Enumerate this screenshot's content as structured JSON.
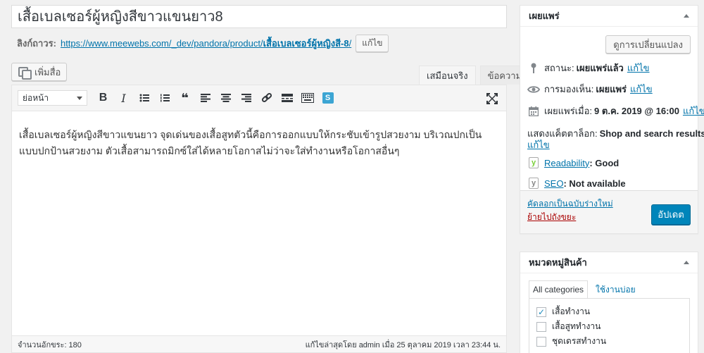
{
  "post": {
    "title": "เสื้อเบลเซอร์ผู้หญิงสีขาวแขนยาว8",
    "permalink_label": "ลิงก์ถาวร:",
    "permalink_base": "https://www.meewebs.com/_dev/pandora/product/",
    "permalink_slug": "เสื้อเบลเซอร์ผู้หญิงสี-8",
    "permalink_tail": "/",
    "edit_slug_label": "แก้ไข"
  },
  "editor": {
    "add_media_label": "เพิ่มสื่อ",
    "tabs": [
      "เสมือนจริง",
      "ข้อความ"
    ],
    "format_select": "ย่อหน้า",
    "toolbar_icons": [
      "bold-icon",
      "italic-icon",
      "bullet-list-icon",
      "numbered-list-icon",
      "blockquote-icon",
      "align-left-icon",
      "align-center-icon",
      "align-right-icon",
      "link-icon",
      "read-more-icon",
      "toolbar-toggle-icon",
      "shortcode-s-icon",
      "fullscreen-icon"
    ],
    "bold_glyph": "B",
    "italic_glyph": "I",
    "quote_glyph": "❝",
    "shortcode_glyph": "S",
    "content": "เสื้อเบลเซอร์ผู้หญิงสีขาวแขนยาว จุดเด่นของเสื้อสูทตัวนี้คือการออกแบบให้กระชับเข้ารูปสวยงาม บริเวณปกเป็นแบบปกป้านสวยงาม ตัวเสื้อสามารถมิกซ์ใส่ได้หลายโอกาสไม่ว่าจะใส่ทำงานหรือโอกาสอื่นๆ",
    "word_count": "จำนวนอักขระ: 180",
    "last_edited": "แก้ไขล่าสุดโดย admin เมื่อ 25 ตุลาคม 2019 เวลา 23:44 น."
  },
  "publish_box": {
    "title": "เผยแพร่",
    "preview_label": "ดูการเปลี่ยนแปลง",
    "status_label": "สถานะ:",
    "status_value": "เผยแพร่แล้ว",
    "visibility_label": "การมองเห็น:",
    "visibility_value": "เผยแพร่",
    "date_label": "เผยแพร่เมื่อ:",
    "date_value": "9 ต.ค. 2019 @ 16:00",
    "edit_label": "แก้ไข",
    "catalog_label": "แสดงแค็ตตาล็อก:",
    "catalog_value": "Shop and search results",
    "readability_label": "Readability",
    "readability_value": ": Good",
    "seo_label": "SEO",
    "seo_value": ": Not available",
    "yoast_glyph": "y",
    "copy_draft_label": "คัดลอกเป็นฉบับร่างใหม่",
    "trash_label": "ย้ายไปถังขยะ",
    "update_label": "อัปเดต"
  },
  "category_box": {
    "title": "หมวดหมู่สินค้า",
    "tab_all": "All categories",
    "tab_popular": "ใช้งานบ่อย",
    "check_glyph": "✓",
    "items": [
      {
        "label": "เสื้อทำงาน",
        "checked": true
      },
      {
        "label": "เสื้อสูททำงาน",
        "checked": false
      },
      {
        "label": "ชุดเดรสทำงาน",
        "checked": false
      }
    ]
  },
  "colors": {
    "link": "#0073aa",
    "primary_button": "#0085ba",
    "trash": "#aa0000",
    "yoast_good": "#7ad03a"
  }
}
